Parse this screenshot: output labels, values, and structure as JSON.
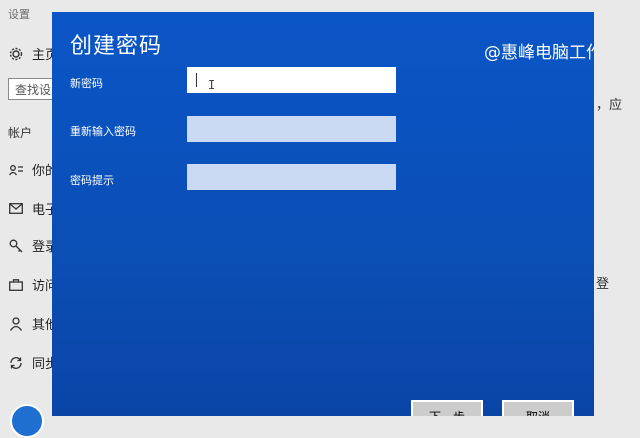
{
  "background": {
    "window_title": "设置",
    "nav_items": [
      {
        "icon": "gear-icon",
        "label": "主页"
      },
      {
        "icon": "account-info-icon",
        "label": "你的"
      },
      {
        "icon": "mail-icon",
        "label": "电子"
      },
      {
        "icon": "key-icon",
        "label": "登录"
      },
      {
        "icon": "briefcase-icon",
        "label": "访问"
      },
      {
        "icon": "person-icon",
        "label": "其他"
      },
      {
        "icon": "sync-icon",
        "label": "同步"
      }
    ],
    "search_placeholder": "查找设置",
    "section_label": "帐户",
    "right_text_1": "，应",
    "right_text_2": "登"
  },
  "dialog": {
    "title": "创建密码",
    "watermark": "@惠峰电脑工作室",
    "fields": [
      {
        "label": "新密码",
        "value": ""
      },
      {
        "label": "重新输入密码",
        "value": ""
      },
      {
        "label": "密码提示",
        "value": ""
      }
    ],
    "next_button": "下一步",
    "cancel_button": "取消"
  }
}
